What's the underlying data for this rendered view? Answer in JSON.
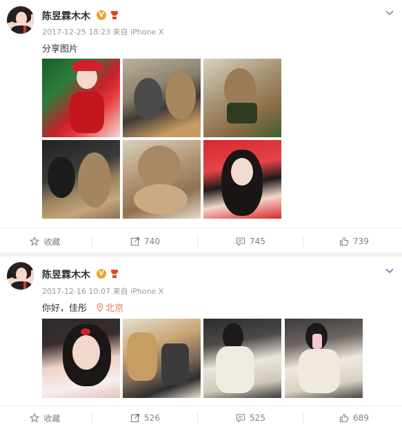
{
  "posts": [
    {
      "author": "陈昱霖木木",
      "verified_badge": "V",
      "time": "2017-12-25 18:23 来自 iPhone X",
      "text": "分享图片",
      "location": "",
      "images": [
        "xmas-girl",
        "cats-hats",
        "cat-box",
        "cats-pair",
        "cat-closeup",
        "girl-red-hood"
      ],
      "actions": {
        "favorite": "收藏",
        "repost": "740",
        "comment": "745",
        "like": "739"
      }
    },
    {
      "author": "陈昱霖木木",
      "verified_badge": "V",
      "time": "2017-12-16 10:07 来自 iPhone X",
      "text": "你好，佳彤",
      "location": "北京",
      "images": [
        "selfie-makeup",
        "glitter-heels",
        "mirror-selfie-1",
        "mirror-selfie-2"
      ],
      "actions": {
        "favorite": "收藏",
        "repost": "526",
        "comment": "525",
        "like": "689"
      }
    }
  ],
  "colors": {
    "location": "#eb7350",
    "meta": "#999999",
    "action": "#808080",
    "badge": "#f0a022"
  },
  "icons": [
    "star-icon",
    "repost-icon",
    "comment-icon",
    "thumb-up-icon",
    "chevron-down-icon",
    "location-pin-icon",
    "gift-badge-icon"
  ]
}
